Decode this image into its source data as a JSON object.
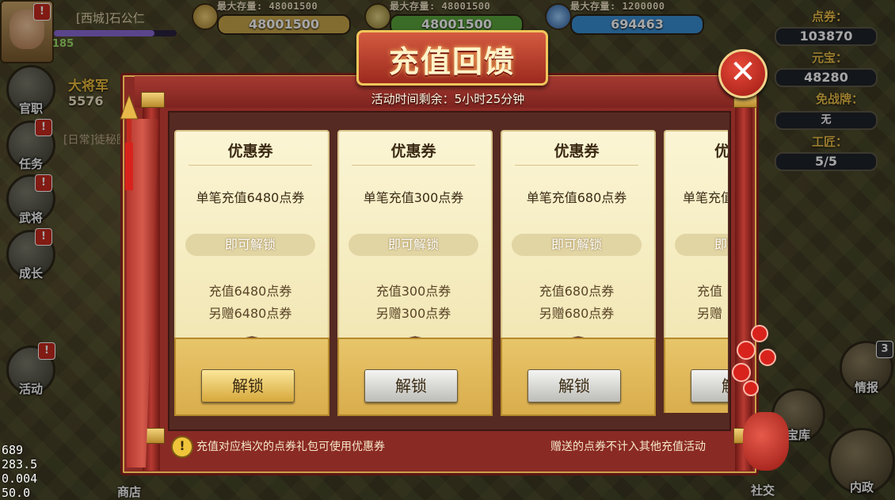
{
  "player": {
    "name": "[西城]石公仁",
    "level": "185",
    "rank_title": "大将军",
    "rank_value": "5576",
    "task_text": "[日常]徒秘图"
  },
  "resources": [
    {
      "cap": "最大存量: 48001500",
      "value": "48001500",
      "color": "#c8a64a"
    },
    {
      "cap": "最大存量: 48001500",
      "value": "48001500",
      "color": "#5aa73c"
    },
    {
      "cap": "最大存量: 1200000",
      "value": "694463",
      "color": "#3a8fd4"
    }
  ],
  "right_stats": {
    "coupon_label": "点券：",
    "coupon_value": "103870",
    "yuanbao_label": "元宝：",
    "yuanbao_value": "48280",
    "pass_label": "免战牌：",
    "pass_value": "无",
    "worker_label": "工匠：",
    "worker_value": "5/5"
  },
  "left_menu": [
    {
      "label": "官职"
    },
    {
      "label": "任务"
    },
    {
      "label": "武将"
    },
    {
      "label": "成长"
    },
    {
      "label": "活动"
    }
  ],
  "right_menu": {
    "report_label": "情报",
    "report_badge": "3",
    "treasury_label": "宝库",
    "admin_label": "内政",
    "social_label": "社交",
    "shop_label": "商店"
  },
  "debug": [
    "689",
    "283.5",
    "0.004",
    "50.0"
  ],
  "panel": {
    "title": "充值回馈",
    "timer": "活动时间剩余：5小时25分钟",
    "footer_left": "充值对应档次的点券礼包可使用优惠券",
    "footer_right": "赠送的点券不计入其他充值活动",
    "close": "✕"
  },
  "cards": [
    {
      "title": "优惠券",
      "condition": "单笔充值6480点券",
      "status": "即可解锁",
      "reward1": "充值6480点券",
      "reward2": "另赠6480点券",
      "button": "解锁",
      "button_style": "gold"
    },
    {
      "title": "优惠券",
      "condition": "单笔充值300点券",
      "status": "即可解锁",
      "reward1": "充值300点券",
      "reward2": "另赠300点券",
      "button": "解锁",
      "button_style": "gray"
    },
    {
      "title": "优惠券",
      "condition": "单笔充值680点券",
      "status": "即可解锁",
      "reward1": "充值680点券",
      "reward2": "另赠680点券",
      "button": "解锁",
      "button_style": "gray"
    },
    {
      "title": "优惠券",
      "condition": "单笔充值",
      "status": "即可解锁",
      "reward1": "充值",
      "reward2": "另赠",
      "button": "解锁",
      "button_style": "gray"
    }
  ],
  "badge_mark": "!"
}
